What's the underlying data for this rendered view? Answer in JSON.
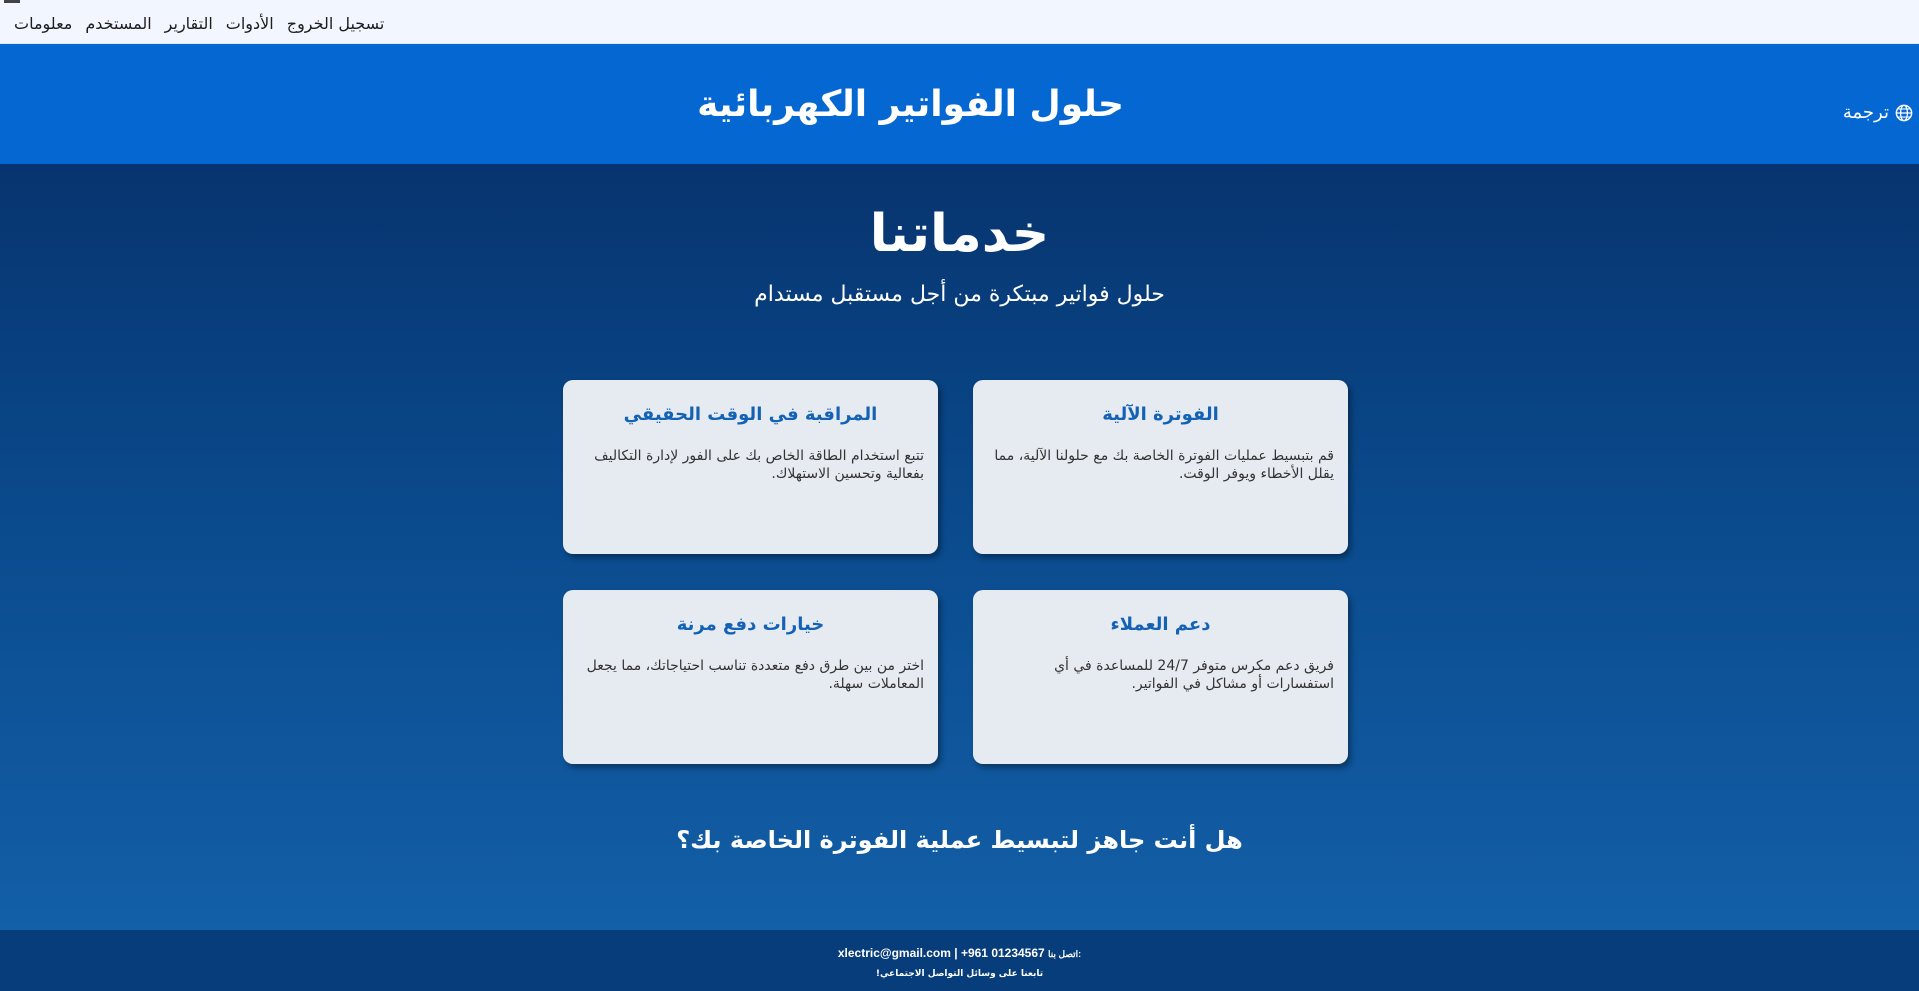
{
  "nav": {
    "items": [
      "معلومات",
      "المستخدم",
      "التقارير",
      "الأدوات",
      "تسجيل الخروج"
    ]
  },
  "header": {
    "title": "حلول الفواتير الكهربائية",
    "translate_label": "ترجمة",
    "translate_icon": "globe-icon"
  },
  "main": {
    "heading": "خدماتنا",
    "subheading": "حلول فواتير مبتكرة من أجل مستقبل مستدام",
    "cards": [
      {
        "title": "الفوترة الآلية",
        "text": "قم بتبسيط عمليات الفوترة الخاصة بك مع حلولنا الآلية، مما يقلل الأخطاء ويوفر الوقت."
      },
      {
        "title": "المراقبة في الوقت الحقيقي",
        "text": "تتبع استخدام الطاقة الخاص بك على الفور لإدارة التكاليف بفعالية وتحسين الاستهلاك."
      },
      {
        "title": "دعم العملاء",
        "text": "فريق دعم مكرس متوفر 24/7 للمساعدة في أي استفسارات أو مشاكل في الفواتير."
      },
      {
        "title": "خيارات دفع مرنة",
        "text": "اختر من بين طرق دفع متعددة تناسب احتياجاتك، مما يجعل المعاملات سهلة."
      }
    ],
    "cta": "هل أنت جاهز لتبسيط عملية الفوترة الخاصة بك؟"
  },
  "footer": {
    "contact_label": "اتصل بنا:",
    "contact_value": "xlectric@gmail.com | +961 01234567",
    "follow": "تابعنا على وسائل التواصل الاجتماعي!"
  },
  "colors": {
    "nav_bg": "#f2f7ff",
    "header_bg": "#0567d1",
    "main_gradient_top": "#07346f",
    "main_gradient_bottom": "#135fa8",
    "card_bg": "#e6ebf1",
    "card_title": "#1462b5",
    "footer_bg": "#063d7a"
  }
}
